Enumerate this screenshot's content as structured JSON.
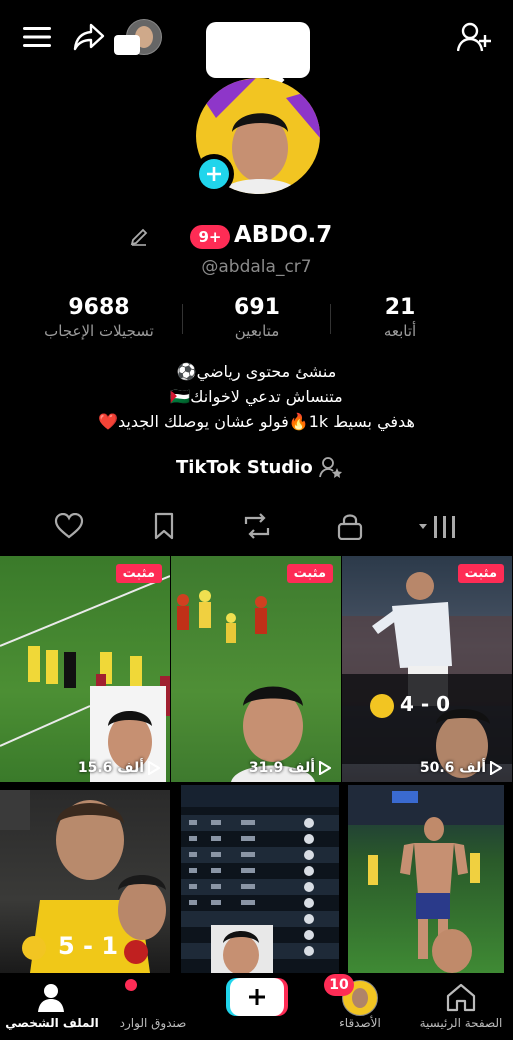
{
  "header": {
    "username": "ABDO.7",
    "handle": "@abdala_cr7",
    "notif_badge": "9+"
  },
  "stats": [
    {
      "value": "21",
      "label": "أتابعه"
    },
    {
      "value": "691",
      "label": "متابعين"
    },
    {
      "value": "9688",
      "label": "تسجيلات الإعجاب"
    }
  ],
  "bio": {
    "line1": "منشئ محتوى رياضي⚽",
    "line2": "متنساش تدعي لاخوانك🇵🇸",
    "line3": "هدفي بسيط 1k🔥فولو عشان يوصلك الجديد❤️"
  },
  "studio_label": "TikTok Studio",
  "videos": [
    {
      "pinned": "مثبت",
      "views": "50.6 ألف"
    },
    {
      "pinned": "مثبت",
      "views": "31.9 ألف"
    },
    {
      "pinned": "مثبت",
      "views": "15.6 ألف"
    },
    {
      "score": "4 - 0"
    },
    {
      "score": "5 - 1"
    }
  ],
  "nav": {
    "home": "الصفحة الرئيسية",
    "friends": "الأصدقاء",
    "friends_badge": "10",
    "inbox": "صندوق الوارد",
    "profile": "الملف الشخصي"
  },
  "colors": {
    "accent": "#fe2c55",
    "blue": "#20d5ec",
    "background": "#000000"
  }
}
